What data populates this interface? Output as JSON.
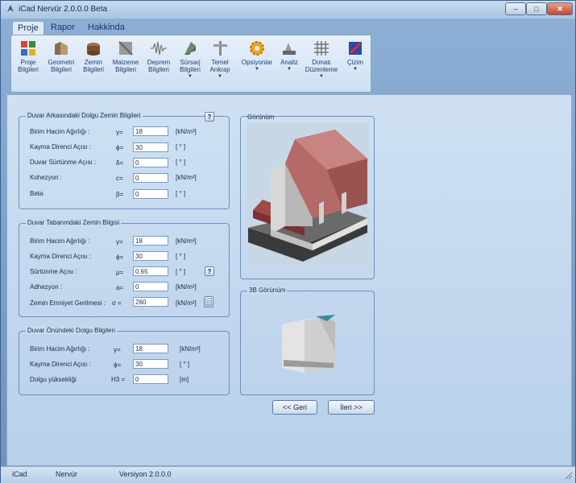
{
  "window": {
    "title": "iCad Nervür 2.0.0.0 Beta",
    "controls": {
      "minimize": "–",
      "maximize": "□",
      "close": "✕"
    }
  },
  "ribbon_tabs": [
    "Proje",
    "Rapor",
    "Hakkinda"
  ],
  "ribbon_buttons": [
    {
      "label": "Proje\nBilgileri",
      "icon": "project-info-icon"
    },
    {
      "label": "Geometri\nBilgileri",
      "icon": "geometry-icon"
    },
    {
      "label": "Zemin\nBilgileri",
      "icon": "soil-icon"
    },
    {
      "label": "Malzeme\nBilgileri",
      "icon": "material-icon"
    },
    {
      "label": "Deprem\nBilgileri",
      "icon": "earthquake-icon"
    },
    {
      "label": "Sürsarj\nBilgileri",
      "icon": "surcharge-icon"
    },
    {
      "label": "Temel\nAnkrajı",
      "icon": "anchor-icon"
    },
    {
      "label": "Opsiyonlar",
      "icon": "options-gear-icon"
    },
    {
      "label": "Analiz",
      "icon": "analysis-icon"
    },
    {
      "label": "Donatı\nDüzenleme",
      "icon": "rebar-icon"
    },
    {
      "label": "Çizim",
      "icon": "drawing-icon"
    }
  ],
  "back_fill": {
    "title": "Duvar Arkasındaki Dolgu Zemin Bilgileri",
    "rows": [
      {
        "label": "Birim Hacim Ağırlığı :",
        "symbol": "γ=",
        "value": "18",
        "unit": "[kN/m³]"
      },
      {
        "label": "Kayma Direnci Açısı :",
        "symbol": "ϕ=",
        "value": "30",
        "unit": "[ ° ]"
      },
      {
        "label": "Duvar Sürtünme Açısı :",
        "symbol": "δ=",
        "value": "0",
        "unit": "[ ° ]"
      },
      {
        "label": "Kohezyon :",
        "symbol": "c=",
        "value": "0",
        "unit": "[kN/m²]"
      },
      {
        "label": "Beta",
        "symbol": "β=",
        "value": "0",
        "unit": "[ ° ]"
      }
    ]
  },
  "base_soil": {
    "title": "Duvar Tabanındaki  Zemin Bilgisi",
    "rows": [
      {
        "label": "Birim Hacim Ağırlığı :",
        "symbol": "γ=",
        "value": "18",
        "unit": "[kN/m³]"
      },
      {
        "label": "Kayma Direnci Açısı :",
        "symbol": "ϕ=",
        "value": "30",
        "unit": "[ ° ]"
      },
      {
        "label": "Sürtünme Açısı :",
        "symbol": "μ=",
        "value": "0.65",
        "unit": "[ ° ]"
      },
      {
        "label": "Adhezyon :",
        "symbol": "a=",
        "value": "0",
        "unit": "[kN/m²]"
      },
      {
        "label": "Zemin Emniyet Gerilmesi :",
        "symbol": "σ =",
        "value": "260",
        "unit": "[kN/m²]"
      }
    ]
  },
  "front_fill": {
    "title": "Duvar Önündeki Dolgu Bilgileri",
    "rows": [
      {
        "label": "Birim Hacim Ağırlığı :",
        "symbol": "γ=",
        "value": "18",
        "unit": "[kN/m³]"
      },
      {
        "label": "Kayma Direnci Açısı :",
        "symbol": "ϕ=",
        "value": "30",
        "unit": "[ ° ]"
      },
      {
        "label": "Dolgu yüksekliği",
        "symbol": "H3 =",
        "value": "0",
        "unit": "[m]"
      }
    ]
  },
  "view_panel": {
    "title": "Görünüm"
  },
  "view3d_panel": {
    "title": "3B Görünüm"
  },
  "help_label": "?",
  "nav": {
    "back": "<< Geri",
    "next": "İleri >>"
  },
  "status": {
    "app": "iCad",
    "module": "Nervür",
    "version": "Versiyon 2.0.0.0"
  }
}
